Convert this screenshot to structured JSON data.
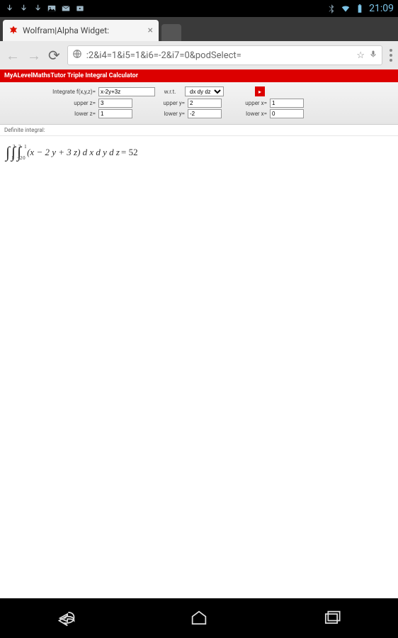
{
  "status": {
    "time": "21:09"
  },
  "tab": {
    "title": "Wolfram|Alpha Widget:"
  },
  "url": {
    "display": ":2&i4=1&i5=1&i6=-2&i7=0&podSelect="
  },
  "page": {
    "title": "MyALevelMathsTutor Triple Integral Calculator",
    "fn_label": "Integrate f(x,y,z)=",
    "fn_value": "x-2y+3z",
    "wrt_label": "w.r.t.",
    "wrt_value": "dx dy dz",
    "upper_z_label": "upper z=",
    "upper_z": "3",
    "lower_z_label": "lower z=",
    "lower_z": "1",
    "upper_y_label": "upper y=",
    "upper_y": "2",
    "lower_y_label": "lower y=",
    "lower_y": "-2",
    "upper_x_label": "upper x=",
    "upper_x": "1",
    "lower_x_label": "lower x=",
    "lower_x": "0",
    "result_label": "Definite integral:",
    "integral": {
      "z_lo": "1",
      "z_hi": "3",
      "y_lo": "−2",
      "y_hi": "2",
      "x_lo": "0",
      "x_hi": "1",
      "expr": "(x − 2 y + 3 z) d x d y d z",
      "eq": " = 52"
    }
  }
}
